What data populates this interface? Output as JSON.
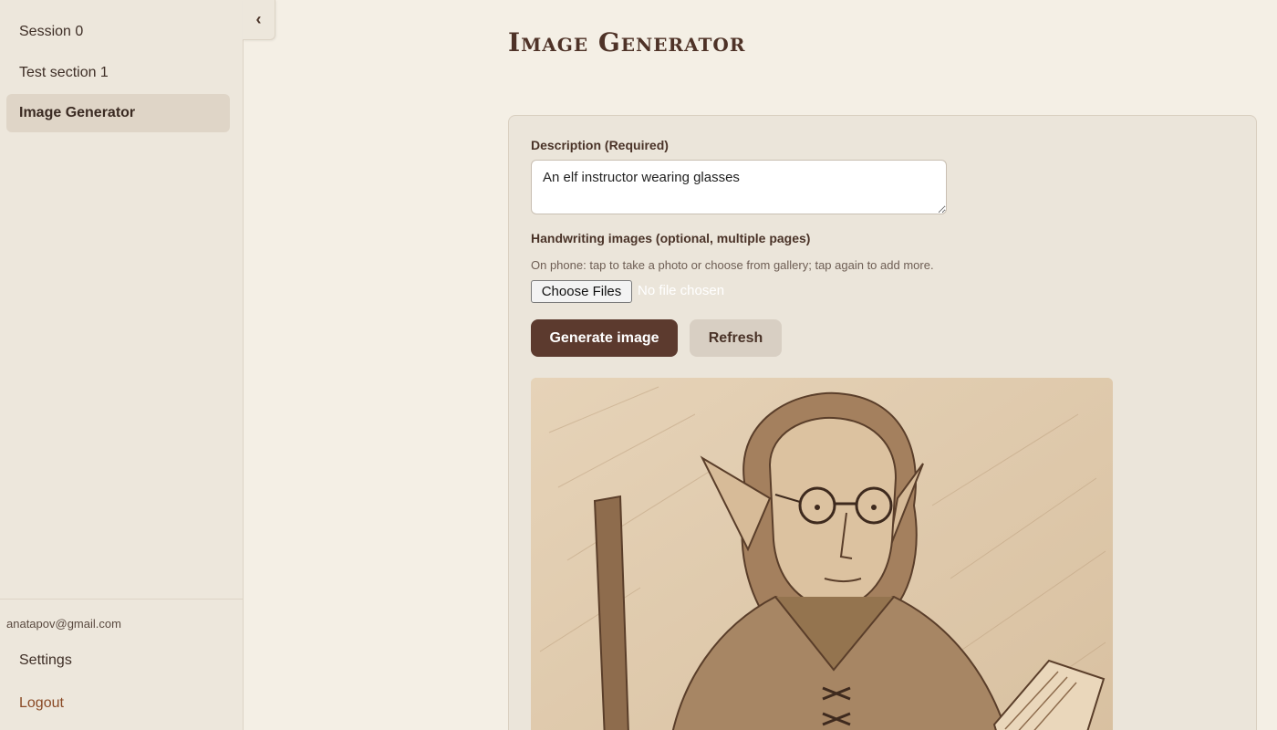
{
  "sidebar": {
    "items": [
      {
        "label": "Session 0"
      },
      {
        "label": "Test section 1"
      },
      {
        "label": "Image Generator"
      }
    ],
    "user_email": "anatapov@gmail.com",
    "settings_label": "Settings",
    "logout_label": "Logout",
    "collapse_glyph": "‹"
  },
  "main": {
    "title": "Image Generator",
    "description_label": "Description (Required)",
    "description_value": "An elf instructor wearing glasses",
    "handwriting_label": "Handwriting images (optional, multiple pages)",
    "hint": "On phone: tap to take a photo or choose from gallery; tap again to add more.",
    "choose_files_label": "Choose Files",
    "file_status": "No file chosen",
    "generate_label": "Generate image",
    "refresh_label": "Refresh"
  },
  "colors": {
    "background": "#f4efe5",
    "sidebar": "#ede7dc",
    "primary_button": "#5c3a2e",
    "accent_text": "#8a4a26"
  },
  "icons": {
    "collapse": "chevron-left-icon"
  }
}
